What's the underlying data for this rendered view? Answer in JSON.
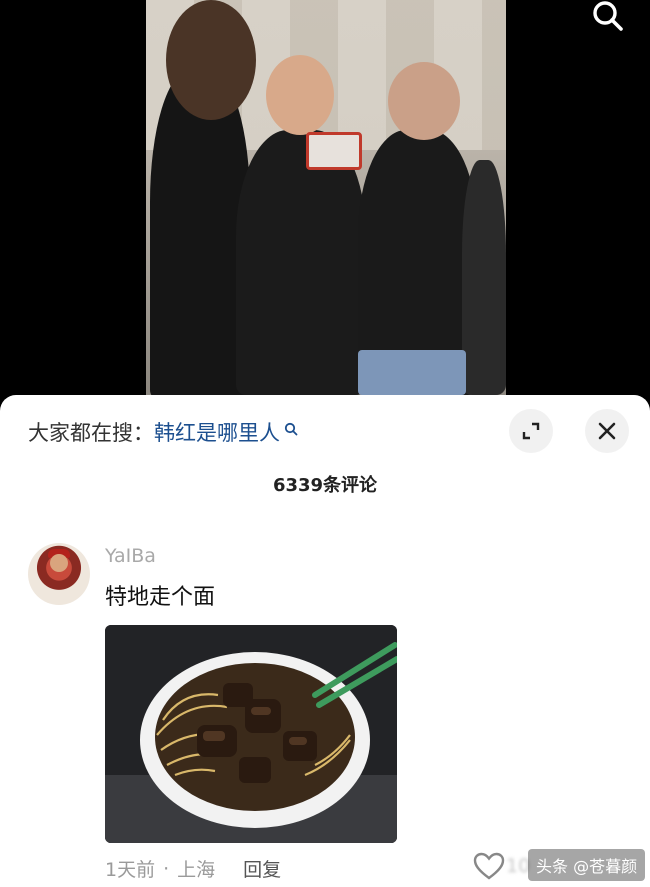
{
  "hot_search": {
    "prefix": "大家都在搜：",
    "keyword": "韩红是哪里人"
  },
  "comments_header": {
    "count_label": "6339条评论"
  },
  "comment": {
    "username": "YaIBa",
    "text": "特地走个面",
    "time": "1天前",
    "separator": "·",
    "location": "上海",
    "reply_label": "回复",
    "like_count": "10"
  },
  "watermark": {
    "text": "头条 @苍暮颜"
  },
  "icons": {
    "top_search": "search-icon",
    "hot_search_mag": "magnifier-icon",
    "expand": "expand-icon",
    "close": "close-icon",
    "like": "heart-icon"
  },
  "colors": {
    "keyword": "#1c4f8f",
    "sheet_bg": "#ffffff",
    "muted": "#9a9a9a"
  }
}
